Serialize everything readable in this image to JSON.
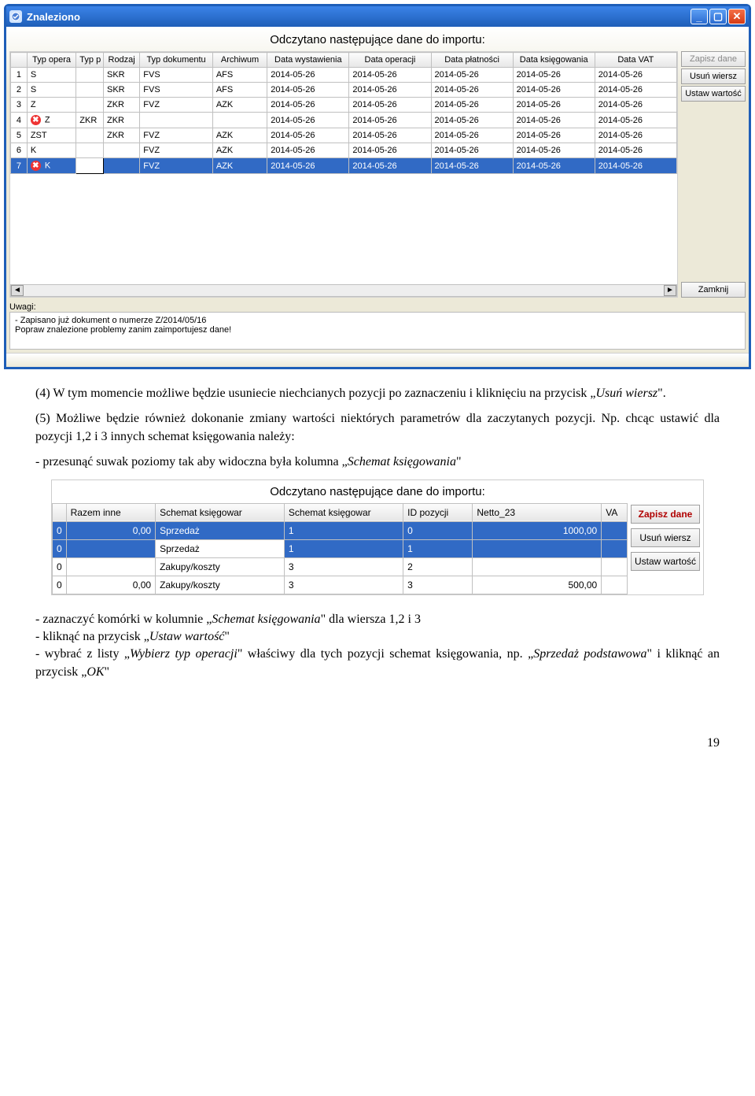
{
  "window": {
    "title": "Znaleziono",
    "section_title": "Odczytano następujące dane do importu:",
    "buttons": {
      "save": "Zapisz dane",
      "delete_row": "Usuń wiersz",
      "set_value": "Ustaw wartość",
      "close": "Zamknij"
    },
    "headers": [
      "",
      "Typ opera",
      "Typ p",
      "Rodzaj",
      "Typ dokumentu",
      "Archiwum",
      "Data wystawienia",
      "Data operacji",
      "Data płatności",
      "Data księgowania",
      "Data VAT"
    ],
    "rows": [
      {
        "n": "1",
        "err": false,
        "c": [
          "S",
          "",
          "SKR",
          "FVS",
          "AFS",
          "2014-05-26",
          "2014-05-26",
          "2014-05-26",
          "2014-05-26",
          "2014-05-26"
        ]
      },
      {
        "n": "2",
        "err": false,
        "c": [
          "S",
          "",
          "SKR",
          "FVS",
          "AFS",
          "2014-05-26",
          "2014-05-26",
          "2014-05-26",
          "2014-05-26",
          "2014-05-26"
        ]
      },
      {
        "n": "3",
        "err": false,
        "c": [
          "Z",
          "",
          "ZKR",
          "FVZ",
          "AZK",
          "2014-05-26",
          "2014-05-26",
          "2014-05-26",
          "2014-05-26",
          "2014-05-26"
        ]
      },
      {
        "n": "4",
        "err": true,
        "c": [
          "Z",
          "ZKR",
          "ZKR",
          "",
          "",
          "2014-05-26",
          "2014-05-26",
          "2014-05-26",
          "2014-05-26",
          "2014-05-26"
        ]
      },
      {
        "n": "5",
        "err": false,
        "c": [
          "ZST",
          "",
          "ZKR",
          "FVZ",
          "AZK",
          "2014-05-26",
          "2014-05-26",
          "2014-05-26",
          "2014-05-26",
          "2014-05-26"
        ]
      },
      {
        "n": "6",
        "err": false,
        "c": [
          "K",
          "",
          "",
          "FVZ",
          "AZK",
          "2014-05-26",
          "2014-05-26",
          "2014-05-26",
          "2014-05-26",
          "2014-05-26"
        ]
      },
      {
        "n": "7",
        "err": true,
        "sel": true,
        "c": [
          "K",
          "",
          "",
          "FVZ",
          "AZK",
          "2014-05-26",
          "2014-05-26",
          "2014-05-26",
          "2014-05-26",
          "2014-05-26"
        ]
      }
    ],
    "uwagi_label": "Uwagi:",
    "uwagi_line1": "- Zapisano już dokument o numerze Z/2014/05/16",
    "uwagi_line2": "Popraw znalezione problemy zanim zaimportujesz dane!"
  },
  "text": {
    "p1a": "(4) W tym momencie możliwe będzie usuniecie niechcianych pozycji po zaznaczeniu i kliknięciu na przycisk „",
    "p1i": "Usuń wiersz",
    "p1b": "\".",
    "p2a": "(5) Możliwe będzie również dokonanie zmiany wartości niektórych parametrów dla zaczytanych pozycji. Np. chcąc ustawić dla pozycji 1,2 i 3 innych schemat księgowania należy:",
    "p3a": "- przesunąć suwak poziomy tak aby widoczna była kolumna „",
    "p3i": "Schemat księgowania",
    "p3b": "\"",
    "p4a": "- zaznaczyć komórki w kolumnie „",
    "p4i": "Schemat księgowania",
    "p4b": "\" dla wiersza 1,2 i 3",
    "p5a": "- kliknąć na przycisk „",
    "p5i": "Ustaw wartość",
    "p5b": "\"",
    "p6a": "- wybrać z listy „",
    "p6i": "Wybierz typ operacji",
    "p6b": "\" właściwy dla tych pozycji schemat księgowania, np. „",
    "p6i2": "Sprzedaż podstawowa",
    "p6c": "\" i kliknąć an przycisk „",
    "p6i3": "OK",
    "p6d": "\""
  },
  "img2": {
    "title": "Odczytano następujące dane do importu:",
    "headers": [
      "Razem inne",
      "Schemat księgowar",
      "Schemat księgowar",
      "ID pozycji",
      "Netto_23",
      "VA"
    ],
    "rows": [
      {
        "sel": true,
        "c": [
          "0",
          "0,00",
          "Sprzedaż",
          "1",
          "0",
          "1000,00",
          ""
        ]
      },
      {
        "sel": true,
        "white": true,
        "c": [
          "0",
          "",
          "Sprzedaż",
          "1",
          "1",
          "",
          ""
        ]
      },
      {
        "sel": false,
        "c": [
          "0",
          "",
          "Zakupy/koszty",
          "3",
          "2",
          "",
          ""
        ]
      },
      {
        "sel": false,
        "c": [
          "0",
          "0,00",
          "Zakupy/koszty",
          "3",
          "3",
          "500,00",
          ""
        ]
      }
    ],
    "buttons": {
      "save": "Zapisz dane",
      "del": "Usuń wiersz",
      "set": "Ustaw wartość"
    }
  },
  "pagenum": "19"
}
